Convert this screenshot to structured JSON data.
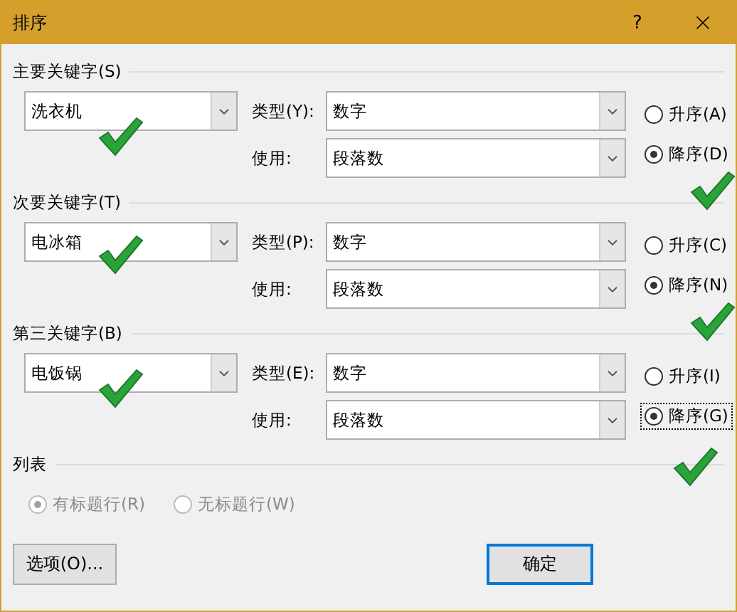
{
  "window": {
    "title": "排序",
    "help": "?"
  },
  "keys": [
    {
      "heading": "主要关键字(S)",
      "field": "洗衣机",
      "type_label": "类型(Y):",
      "type_value": "数字",
      "using_label": "使用:",
      "using_value": "段落数",
      "orders": [
        {
          "label": "升序(A)",
          "selected": false,
          "focused": false
        },
        {
          "label": "降序(D)",
          "selected": true,
          "focused": false
        }
      ]
    },
    {
      "heading": "次要关键字(T)",
      "field": "电冰箱",
      "type_label": "类型(P):",
      "type_value": "数字",
      "using_label": "使用:",
      "using_value": "段落数",
      "orders": [
        {
          "label": "升序(C)",
          "selected": false,
          "focused": false
        },
        {
          "label": "降序(N)",
          "selected": true,
          "focused": false
        }
      ]
    },
    {
      "heading": "第三关键字(B)",
      "field": "电饭锅",
      "type_label": "类型(E):",
      "type_value": "数字",
      "using_label": "使用:",
      "using_value": "段落数",
      "orders": [
        {
          "label": "升序(I)",
          "selected": false,
          "focused": false
        },
        {
          "label": "降序(G)",
          "selected": true,
          "focused": true
        }
      ]
    }
  ],
  "list": {
    "heading": "列表",
    "disabled": true,
    "options": [
      {
        "label": "有标题行(R)",
        "selected": true
      },
      {
        "label": "无标题行(W)",
        "selected": false
      }
    ]
  },
  "buttons": [
    {
      "label": "选项(O)...",
      "default": false
    },
    {
      "label": "确定",
      "default": true
    }
  ]
}
